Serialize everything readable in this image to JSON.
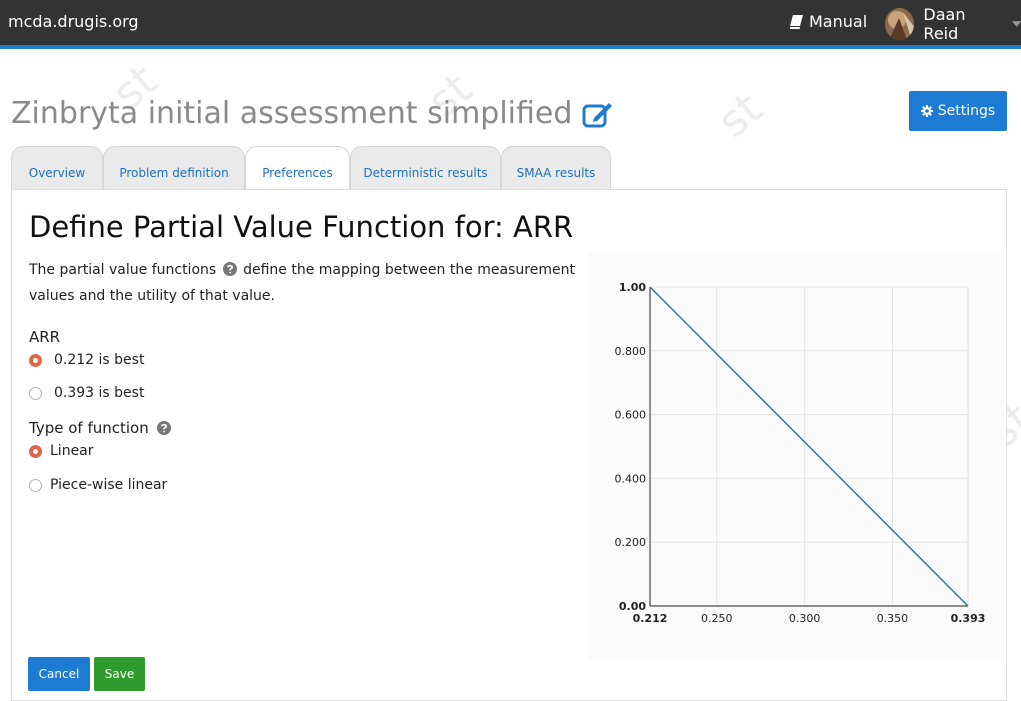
{
  "header": {
    "brand": "mcda.drugis.org",
    "manual_label": "Manual",
    "user_name": "Daan Reid"
  },
  "watermark_text": "st",
  "page": {
    "title": "Zinbryta initial assessment simplified",
    "settings_label": "Settings"
  },
  "tabs": [
    {
      "label": "Overview",
      "active": false
    },
    {
      "label": "Problem definition",
      "active": false
    },
    {
      "label": "Preferences",
      "active": true
    },
    {
      "label": "Deterministic results",
      "active": false
    },
    {
      "label": "SMAA results",
      "active": false
    }
  ],
  "main": {
    "heading": "Define Partial Value Function for: ARR",
    "description_pre": "The partial value functions",
    "description_post": "define the mapping between the measurement values and the utility of that value.",
    "criterion_label": "ARR",
    "best_options": [
      {
        "label": "0.212 is best",
        "checked": true
      },
      {
        "label": "0.393 is best",
        "checked": false
      }
    ],
    "function_type_label": "Type of function",
    "function_types": [
      {
        "label": "Linear",
        "checked": true
      },
      {
        "label": "Piece-wise linear",
        "checked": false
      }
    ],
    "cancel_label": "Cancel",
    "save_label": "Save"
  },
  "colors": {
    "accent": "#1e7bd3",
    "save": "#2f9b2c",
    "radio_checked": "#e0664a",
    "line": "#2a7ab0"
  },
  "chart_data": {
    "type": "line",
    "title": "",
    "xlabel": "",
    "ylabel": "",
    "xlim": [
      0.212,
      0.393
    ],
    "ylim": [
      0.0,
      1.0
    ],
    "x_ticks": [
      {
        "value": 0.212,
        "label": "0.212",
        "bold": true
      },
      {
        "value": 0.25,
        "label": "0.250",
        "bold": false
      },
      {
        "value": 0.3,
        "label": "0.300",
        "bold": false
      },
      {
        "value": 0.35,
        "label": "0.350",
        "bold": false
      },
      {
        "value": 0.393,
        "label": "0.393",
        "bold": true
      }
    ],
    "y_ticks": [
      {
        "value": 0.0,
        "label": "0.00",
        "bold": true
      },
      {
        "value": 0.2,
        "label": "0.200",
        "bold": false
      },
      {
        "value": 0.4,
        "label": "0.400",
        "bold": false
      },
      {
        "value": 0.6,
        "label": "0.600",
        "bold": false
      },
      {
        "value": 0.8,
        "label": "0.800",
        "bold": false
      },
      {
        "value": 1.0,
        "label": "1.00",
        "bold": true
      }
    ],
    "grid": true,
    "series": [
      {
        "x": [
          0.212,
          0.393
        ],
        "y": [
          1.0,
          0.0
        ]
      }
    ]
  }
}
